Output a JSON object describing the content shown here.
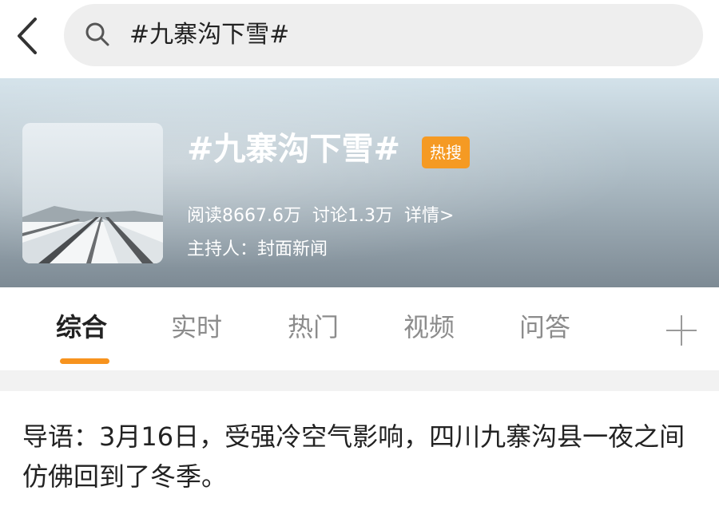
{
  "search": {
    "query": "#九寨沟下雪#"
  },
  "topic": {
    "title": "#九寨沟下雪#",
    "badge": "热搜",
    "reads": "阅读8667.6万",
    "discussions": "讨论1.3万",
    "detail_link": "详情>",
    "host": "主持人：封面新闻"
  },
  "tabs": [
    {
      "label": "综合"
    },
    {
      "label": "实时"
    },
    {
      "label": "热门"
    },
    {
      "label": "视频"
    },
    {
      "label": "问答"
    }
  ],
  "intro": "导语：3月16日，受强冷空气影响，四川九寨沟县一夜之间仿佛回到了冬季。",
  "colors": {
    "accent": "#f7931e",
    "badge": "#f59a23",
    "inactive_tab": "#8c8c8c"
  },
  "icons": {
    "back": "chevron-left-icon",
    "search": "search-icon",
    "add_tab": "plus-icon"
  }
}
